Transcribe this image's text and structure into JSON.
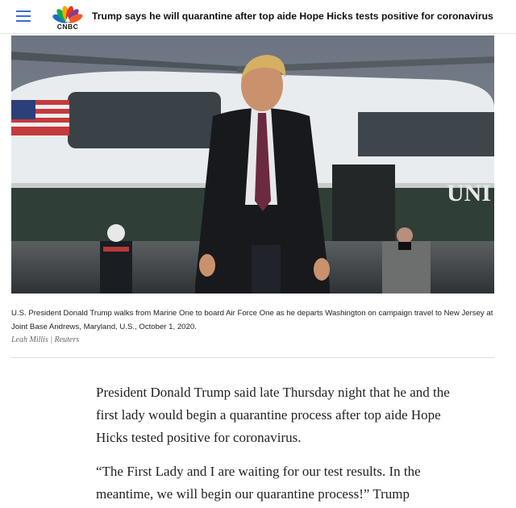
{
  "header": {
    "menu_icon": "hamburger-menu-icon",
    "logo_text": "CNBC",
    "logo_icon": "nbc-peacock-icon",
    "headline": "Trump says he will quarantine after top aide Hope Hicks tests positive for coronavirus"
  },
  "photo": {
    "caption": "U.S. President Donald Trump walks from Marine One to board Air Force One as he departs Washington on campaign travel to New Jersey at Joint Base Andrews, Maryland, U.S., October 1, 2020.",
    "credit": "Leah Millis | Reuters",
    "helicopter_marking": "UNI"
  },
  "article": {
    "paragraphs": [
      "President Donald Trump said late Thursday night that he and the first lady would begin a quarantine process after top aide Hope Hicks tested positive for coronavirus.",
      "“The First Lady and I are waiting for our test results. In the meantime, we will begin our quarantine process!” Trump"
    ]
  },
  "colors": {
    "menu_icon": "#3f6bd0",
    "peacock": [
      "#f6a800",
      "#e9351b",
      "#7c3f98",
      "#1c6ec8",
      "#11a84e",
      "#f15a29"
    ],
    "body_text": "#222222"
  }
}
